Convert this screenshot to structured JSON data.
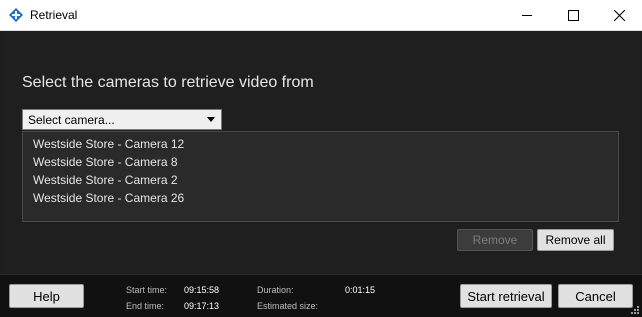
{
  "window": {
    "title": "Retrieval",
    "controls": {
      "minimize": "minimize",
      "maximize": "maximize",
      "close": "close"
    }
  },
  "main": {
    "heading": "Select the cameras to retrieve video from",
    "camera_select": {
      "value": "Select camera..."
    },
    "cameras": [
      "Westside Store - Camera 12",
      "Westside Store - Camera 8",
      "Westside Store - Camera 2",
      "Westside Store - Camera 26"
    ],
    "remove_label": "Remove",
    "remove_all_label": "Remove all"
  },
  "footer": {
    "help_label": "Help",
    "start_time_label": "Start time:",
    "start_time_value": "09:15:58",
    "end_time_label": "End time:",
    "end_time_value": "09:17:13",
    "duration_label": "Duration:",
    "duration_value": "0:01:15",
    "estimated_size_label": "Estimated size:",
    "start_label": "Start retrieval",
    "cancel_label": "Cancel"
  },
  "colors": {
    "accent": "#1e73c8",
    "background": "#1d1d1d",
    "footer": "#111111"
  },
  "icons": [
    "app-logo-icon",
    "minimize-icon",
    "maximize-icon",
    "close-icon",
    "chevron-down-icon",
    "resize-grip-icon"
  ]
}
